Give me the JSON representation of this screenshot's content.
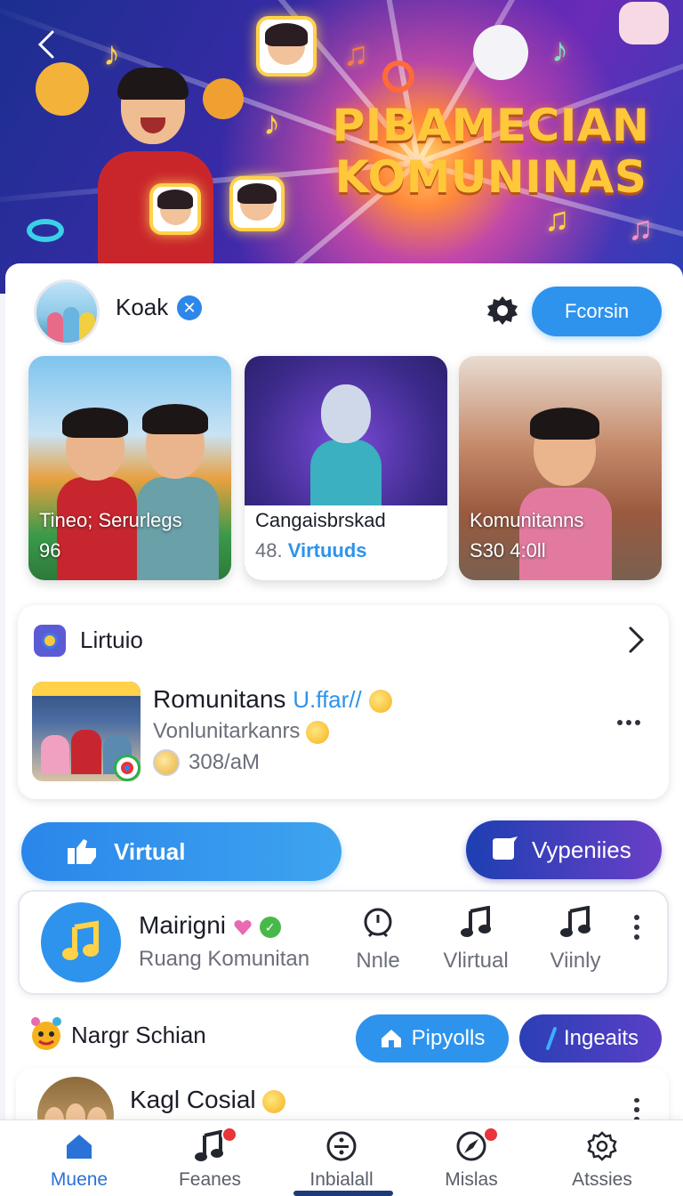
{
  "hero": {
    "title_line1": "PIBAMECIAN",
    "title_line2": "KOMUNINAS"
  },
  "profile": {
    "name": "Koak",
    "follow_label": "Fcorsin"
  },
  "media_cards": [
    {
      "caption": "Tineo; Serurlegs",
      "sub": "96"
    },
    {
      "caption": "Cangaisbrskad",
      "sub_num": "48.",
      "sub_accent": "Virtuuds"
    },
    {
      "caption": "Komunitanns",
      "sub": "S30  4:0ll"
    }
  ],
  "virtual_card": {
    "title": "Lirtuio",
    "item_title": "Romunitans",
    "item_title_accent": "U.ffar//",
    "item_sub": "Vonlunitarkanrs",
    "item_meta": "308/aM"
  },
  "actions": {
    "virtual_label": "Virtual",
    "vypeniies_label": "Vypeniies"
  },
  "music": {
    "title": "Mairigni",
    "subtitle": "Ruang Komunitan",
    "items": [
      {
        "label": "Nnle",
        "icon": "clock-icon"
      },
      {
        "label": "Vlirtual",
        "icon": "music-note-icon"
      },
      {
        "label": "Viinly",
        "icon": "music-note-icon"
      }
    ]
  },
  "section": {
    "title": "Nargr Schian",
    "pip_label": "Pipyolls",
    "ing_label": "Ingeaits",
    "post_name": "Kagl Cosial"
  },
  "nav": {
    "items": [
      {
        "label": "Muene",
        "icon": "home-icon"
      },
      {
        "label": "Feanes",
        "icon": "music-icon"
      },
      {
        "label": "Inbialall",
        "icon": "divide-circle-icon"
      },
      {
        "label": "Mislas",
        "icon": "compass-icon"
      },
      {
        "label": "Atssies",
        "icon": "settings-icon"
      }
    ]
  },
  "colors": {
    "accent": "#2e93ec",
    "accent_dark": "#1d3fb2",
    "badge_red": "#e8343a"
  }
}
